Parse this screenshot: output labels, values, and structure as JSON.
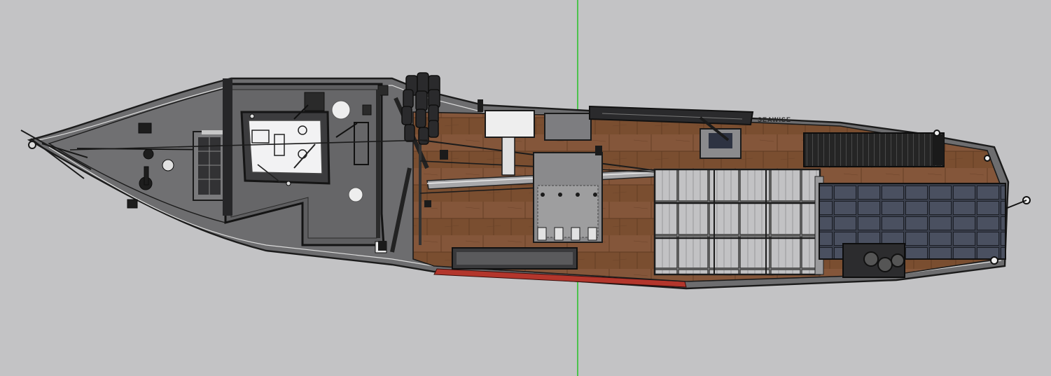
{
  "scene": {
    "background_color": "#c3c3c5",
    "axis_color": "#2ec12e",
    "hull_color": "#6d6d6f",
    "deck_color": "#7a4e30",
    "bridge_color": "#5e5e60",
    "cargo_color": "#b9b9bb",
    "solar_color": "#3a3f4c",
    "waterline_color": "#b3362c",
    "ship_name": "SEAWISE"
  }
}
